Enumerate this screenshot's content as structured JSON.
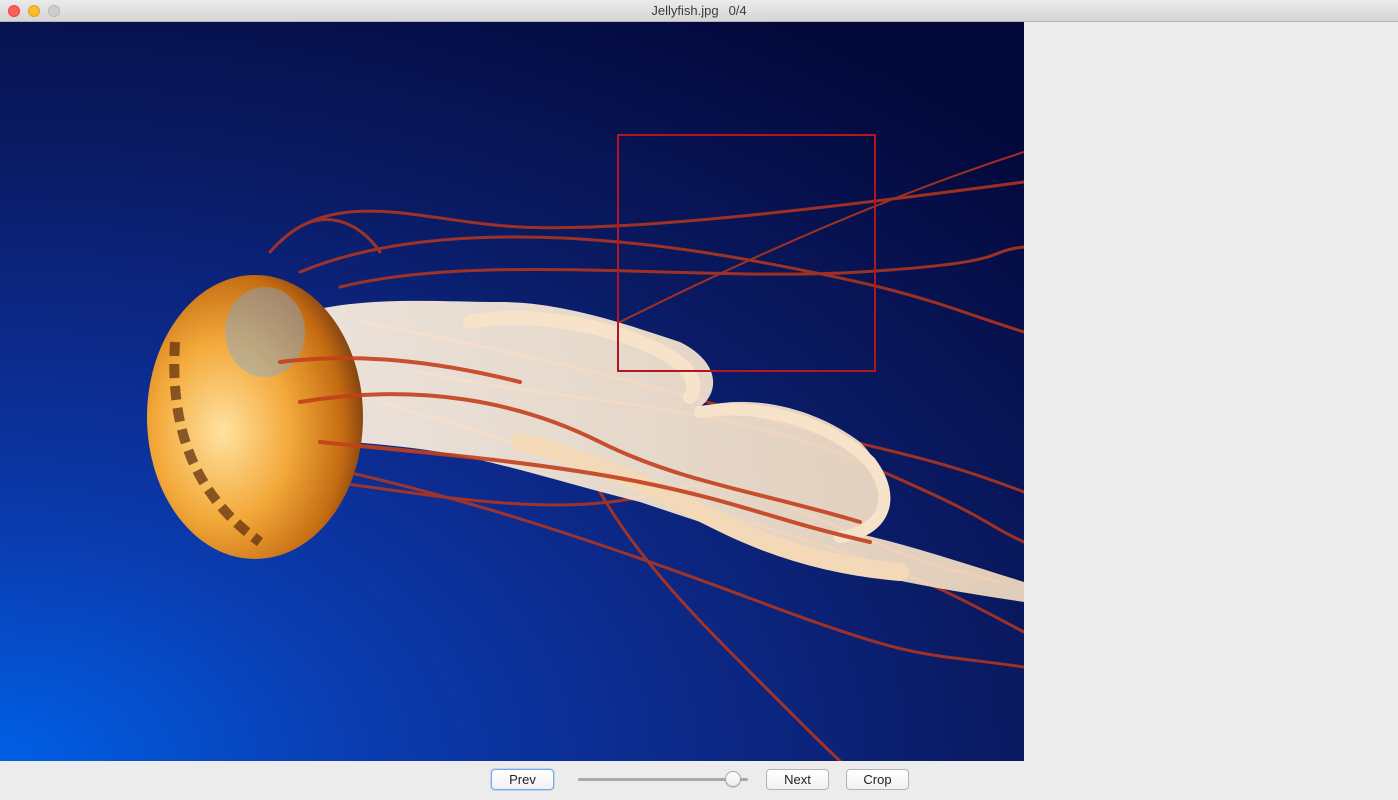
{
  "window": {
    "filename": "Jellyfish.jpg",
    "counter": "0/4"
  },
  "viewer": {
    "image_subject": "jellyfish",
    "selection_color": "#b3161e"
  },
  "toolbar": {
    "prev_label": "Prev",
    "next_label": "Next",
    "crop_label": "Crop",
    "slider_value_fraction": 0.95
  },
  "colors": {
    "close": "#fc5f57",
    "minimize": "#fdbc2e",
    "zoom": "#cdcdcd",
    "focus_ring": "#7aa7e6"
  }
}
